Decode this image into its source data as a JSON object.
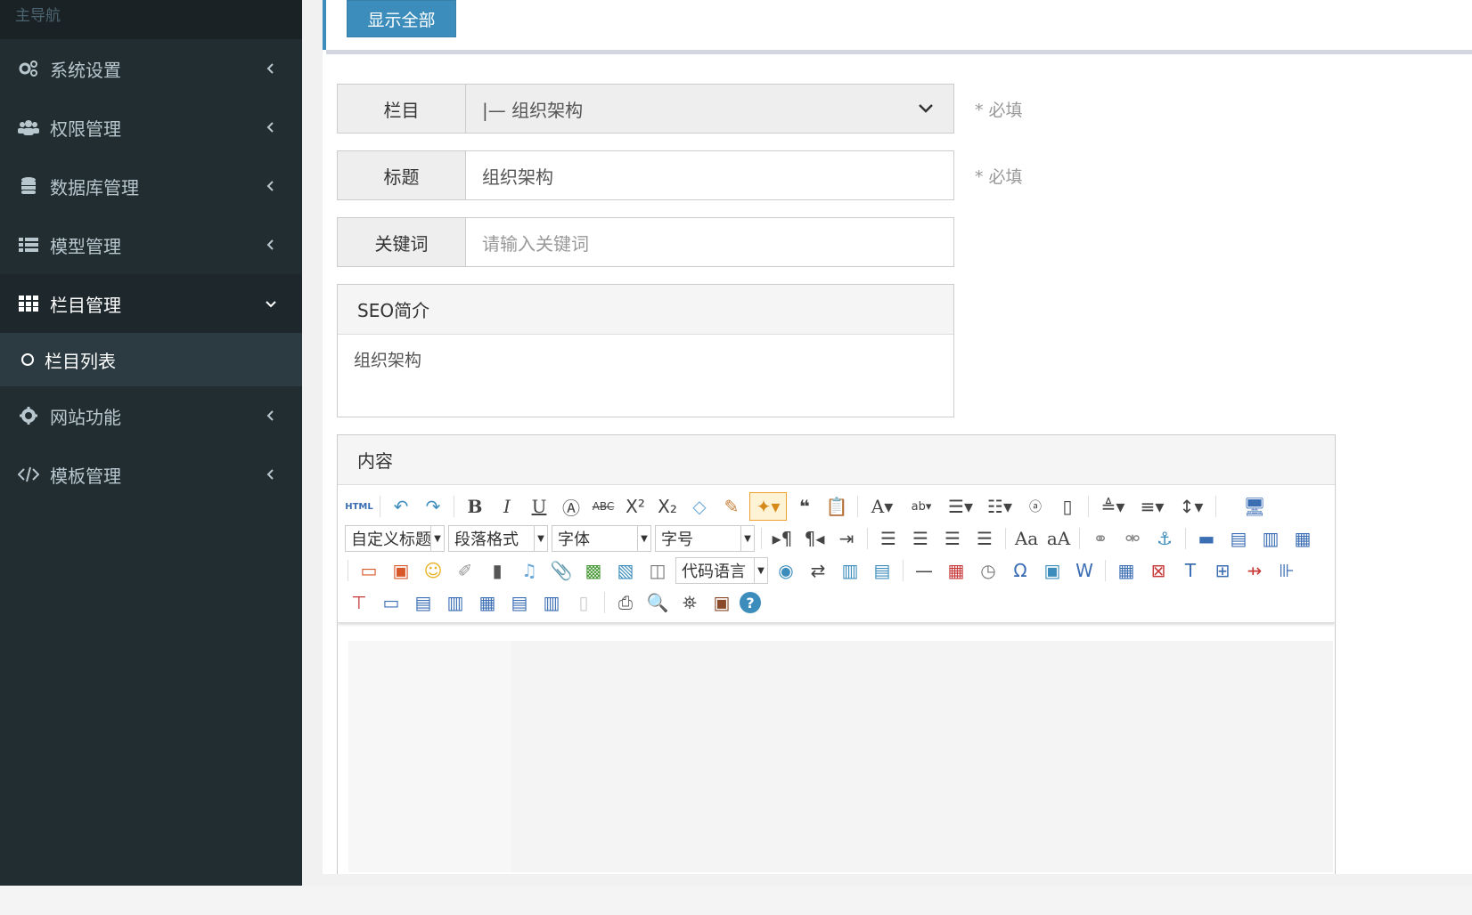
{
  "sidebar": {
    "header": "主导航",
    "items": [
      {
        "label": "系统设置",
        "icon": "cogs-icon"
      },
      {
        "label": "权限管理",
        "icon": "users-icon"
      },
      {
        "label": "数据库管理",
        "icon": "database-icon"
      },
      {
        "label": "模型管理",
        "icon": "list-icon"
      },
      {
        "label": "栏目管理",
        "icon": "grid-icon",
        "active": true
      },
      {
        "label": "网站功能",
        "icon": "gear-icon"
      },
      {
        "label": "模板管理",
        "icon": "code-icon"
      }
    ],
    "sub_item": "栏目列表"
  },
  "topbar": {
    "show_all": "显示全部"
  },
  "form": {
    "column": {
      "label": "栏目",
      "value": "|— 组织架构",
      "required": "* 必填"
    },
    "title": {
      "label": "标题",
      "value": "组织架构",
      "required": "* 必填"
    },
    "keywords": {
      "label": "关键词",
      "placeholder": "请输入关键词"
    },
    "seo": {
      "label": "SEO简介",
      "value": "组织架构"
    },
    "content": {
      "label": "内容"
    }
  },
  "editor": {
    "html_label": "HTML",
    "custom_title": "自定义标题",
    "paragraph": "段落格式",
    "font": "字体",
    "font_size": "字号",
    "code_lang": "代码语言"
  },
  "colors": {
    "sidebar": "#222d32",
    "accent": "#3c8dbc"
  }
}
